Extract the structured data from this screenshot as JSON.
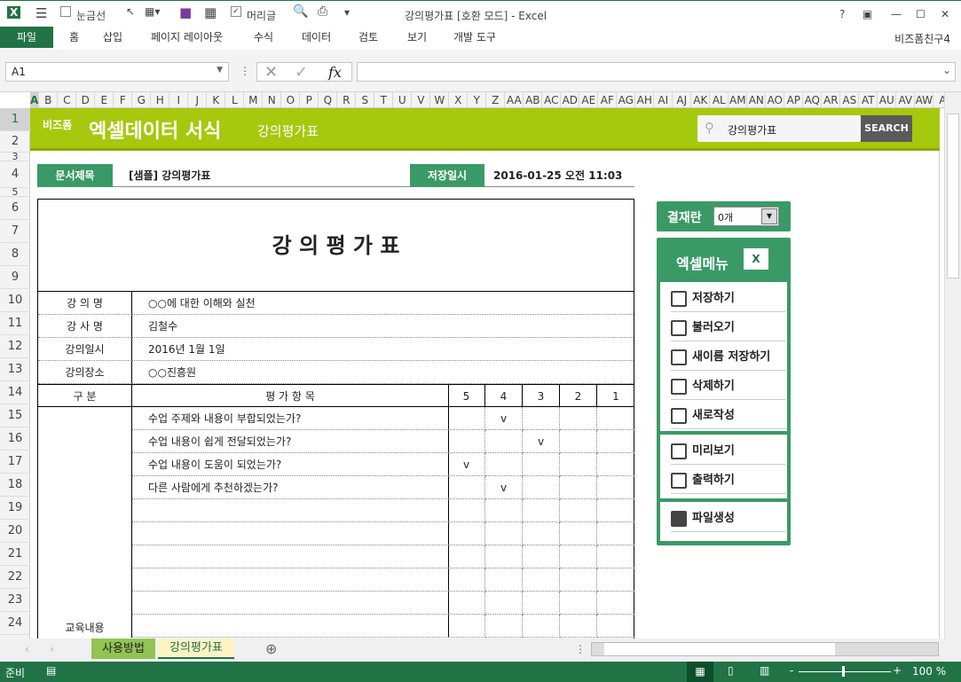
{
  "window": {
    "title": "강의평가표  [호환 모드] - Excel",
    "qat_gridlines": "눈금선",
    "qat_header": "머리글",
    "help": "?",
    "user": "비즈폼친구4"
  },
  "ribbon_tabs": [
    "파일",
    "홈",
    "삽입",
    "페이지 레이아웃",
    "수식",
    "데이터",
    "검토",
    "보기",
    "개발 도구"
  ],
  "formula_bar": {
    "name_box": "A1",
    "fx": "fx",
    "formula": ""
  },
  "columns": [
    "A",
    "B",
    "C",
    "D",
    "E",
    "F",
    "G",
    "H",
    "I",
    "J",
    "K",
    "L",
    "M",
    "N",
    "O",
    "P",
    "Q",
    "R",
    "S",
    "T",
    "U",
    "V",
    "W",
    "X",
    "Y",
    "Z",
    "AA",
    "AB",
    "AC",
    "AD",
    "AE",
    "AF",
    "AG",
    "AH",
    "AI",
    "AJ",
    "AK",
    "AL",
    "AM",
    "AN",
    "AO",
    "AP",
    "AQ",
    "AR",
    "AS",
    "AT",
    "AU",
    "AV",
    "AW",
    "A"
  ],
  "rows": [
    "1",
    "2",
    "3",
    "4",
    "5",
    "6",
    "7",
    "8",
    "9",
    "10",
    "11",
    "12",
    "13",
    "14",
    "15",
    "16",
    "17",
    "18",
    "19",
    "20",
    "21",
    "22",
    "23",
    "24"
  ],
  "banner": {
    "brand_small": "비즈폼",
    "brand": "엑셀데이터 서식",
    "subtitle": "강의평가표",
    "search_value": "강의평가표",
    "search_button": "SEARCH"
  },
  "doc_header": {
    "title_label": "문서제목",
    "title_value": "[샘플] 강의평가표",
    "date_label": "저장일시",
    "date_value": "2016-01-25  오전 11:03"
  },
  "form": {
    "title": "강 의 평 가 표",
    "info": [
      {
        "label": "강 의 명",
        "value": "○○에 대한 이해와 실천"
      },
      {
        "label": "강 사 명",
        "value": "김철수"
      },
      {
        "label": "강의일시",
        "value": "2016년 1월 1일"
      },
      {
        "label": "강의장소",
        "value": "○○진흥원"
      }
    ],
    "header": {
      "category": "구    분",
      "items": "평 가 항 목",
      "scores": [
        "5",
        "4",
        "3",
        "2",
        "1"
      ]
    },
    "section_label": "교육내용",
    "items": [
      {
        "text": "수업 주제와 내용이 부합되었는가?",
        "mark": "v",
        "score": "4"
      },
      {
        "text": "수업 내용이 쉽게 전달되었는가?",
        "mark": "v",
        "score": "3"
      },
      {
        "text": "수업 내용이 도움이 되었는가?",
        "mark": "v",
        "score": "5"
      },
      {
        "text": "다른 사람에게 추천하겠는가?",
        "mark": "v",
        "score": "4"
      },
      {
        "text": "",
        "mark": "",
        "score": ""
      },
      {
        "text": "",
        "mark": "",
        "score": ""
      },
      {
        "text": "",
        "mark": "",
        "score": ""
      },
      {
        "text": "",
        "mark": "",
        "score": ""
      },
      {
        "text": "",
        "mark": "",
        "score": ""
      },
      {
        "text": "",
        "mark": "",
        "score": ""
      }
    ]
  },
  "side": {
    "approval_label": "결재란",
    "approval_value": "0개",
    "menu_title": "엑셀메뉴",
    "group1": [
      "저장하기",
      "불러오기",
      "새이름 저장하기",
      "삭제하기",
      "새로작성"
    ],
    "group2": [
      "미리보기",
      "출력하기"
    ],
    "group3": [
      "파일생성"
    ]
  },
  "sheet_tabs": [
    "사용방법",
    "강의평가표"
  ],
  "status": {
    "ready": "준비",
    "zoom": "100 %"
  },
  "colors": {
    "excel_green": "#217346",
    "banner": "#a6c90e",
    "menu_green": "#3a9a66"
  }
}
